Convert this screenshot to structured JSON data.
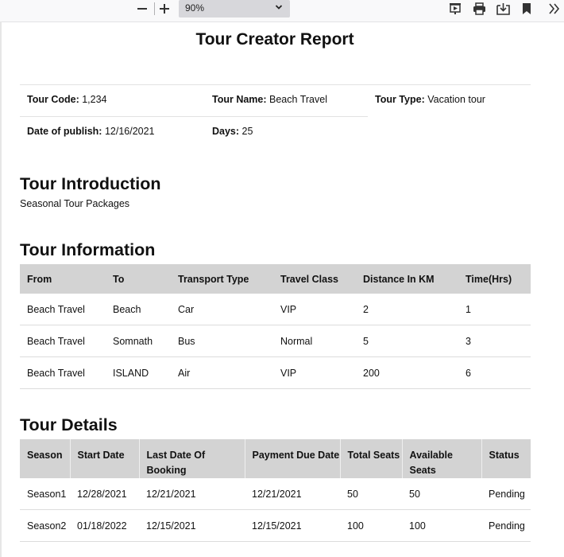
{
  "viewer": {
    "zoom": "90%",
    "icons": [
      "zoom-out-icon",
      "zoom-in-icon",
      "presentation-icon",
      "print-icon",
      "download-icon",
      "bookmark-icon",
      "more-tools-icon"
    ]
  },
  "report": {
    "title": "Tour Creator Report",
    "meta": {
      "tour_code_label": "Tour Code:",
      "tour_code": "1,234",
      "tour_name_label": "Tour Name:",
      "tour_name": "Beach Travel",
      "tour_type_label": "Tour Type:",
      "tour_type": "Vacation tour",
      "publish_label": "Date of publish:",
      "publish_date": "12/16/2021",
      "days_label": "Days:",
      "days": "25"
    },
    "intro_heading": "Tour Introduction",
    "intro_text": "Seasonal Tour Packages",
    "info_heading": "Tour Information",
    "info_headers": [
      "From",
      "To",
      "Transport Type",
      "Travel Class",
      "Distance In KM",
      "Time(Hrs)"
    ],
    "info_rows": [
      [
        "Beach Travel",
        "Beach",
        "Car",
        "VIP",
        "2",
        "1"
      ],
      [
        "Beach Travel",
        "Somnath",
        "Bus",
        "Normal",
        "5",
        "3"
      ],
      [
        "Beach Travel",
        "ISLAND",
        "Air",
        "VIP",
        "200",
        "6"
      ]
    ],
    "details_heading": "Tour Details",
    "details_headers": [
      "Season",
      "Start Date",
      "Last Date Of Booking",
      "Payment Due Date",
      "Total Seats",
      "Available Seats",
      "Status"
    ],
    "details_rows": [
      [
        "Season1",
        "12/28/2021",
        "12/21/2021",
        "12/21/2021",
        "50",
        "50",
        "Pending"
      ],
      [
        "Season2",
        "01/18/2022",
        "12/15/2021",
        "12/15/2021",
        "100",
        "100",
        "Pending"
      ]
    ]
  }
}
